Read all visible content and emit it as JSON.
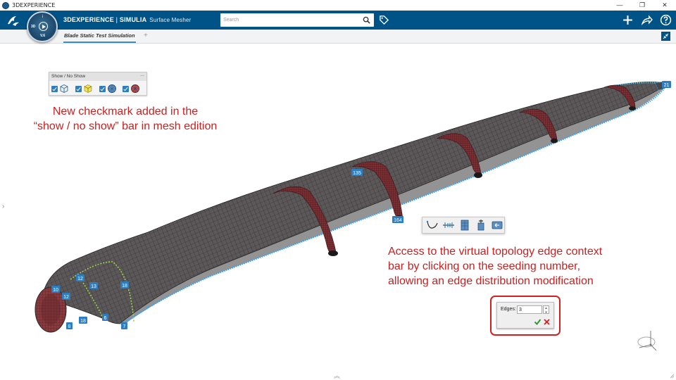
{
  "os": {
    "title": "3DEXPERIENCE",
    "controls": [
      "—",
      "❐",
      "✕"
    ]
  },
  "header": {
    "brand_main": "3DEXPERIENCE",
    "brand_sep": " | ",
    "brand_product": "SIMULIA",
    "brand_app": "Surface Mesher",
    "compass_version": "V.6",
    "compass_3d": "3D",
    "compass_i": "i",
    "search_placeholder": "Search",
    "icons": [
      "search-icon",
      "tag-icon",
      "plus-icon",
      "share-icon",
      "help-icon"
    ]
  },
  "tabs": {
    "active_label": "Blade Static Test Simulation",
    "add_label": "+"
  },
  "show_bar": {
    "title": "Show / No Show",
    "menu_glyph": "...",
    "items": [
      {
        "icon": "geometry-cube-icon",
        "checked": true
      },
      {
        "icon": "yellow-mesh-cube-icon",
        "checked": true
      },
      {
        "icon": "blue-mesh-icon",
        "checked": true
      },
      {
        "icon": "red-mesh-icon",
        "checked": true
      }
    ]
  },
  "annotations": {
    "left_line1": "New checkmark added in the",
    "left_line2": "“show / no show” bar in mesh edition",
    "right_line1": "Access to the virtual topology edge context",
    "right_line2": "bar by clicking on the seeding number,",
    "right_line3": "allowing an edge distribution modification"
  },
  "seed_labels": [
    "21",
    "135",
    "164",
    "12",
    "13",
    "18",
    "10",
    "12",
    "18",
    "6",
    "7",
    "8"
  ],
  "edges_panel": {
    "label": "Edges:",
    "value": "3"
  },
  "colors": {
    "header_bg": "#005386",
    "accent": "#368ec4",
    "annotation": "#cc1f1f",
    "mesh": "#5a5657",
    "ring": "#7a2f33",
    "seed": "#2aa3ff"
  }
}
